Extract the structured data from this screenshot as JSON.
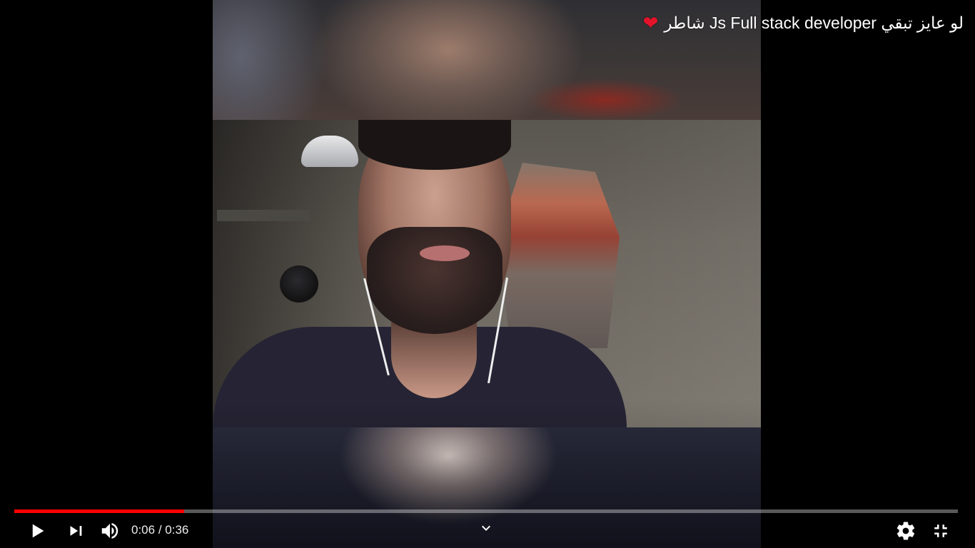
{
  "video": {
    "title": "لو عايز تبقي Js Full stack developer شاطر",
    "title_icon": "heart-icon",
    "title_icon_glyph": "❤"
  },
  "player": {
    "current_time": "0:06",
    "duration": "0:36",
    "time_separator": " / ",
    "progress_played_fraction": 0.18,
    "progress_loaded_fraction": 0.18,
    "colors": {
      "progress_played": "#ff0000",
      "heart": "#e5132a"
    },
    "controls": {
      "play_icon": "play-icon",
      "next_icon": "next-icon",
      "volume_icon": "volume-icon",
      "chevron_icon": "chevron-down-icon",
      "settings_icon": "gear-icon",
      "exit_fullscreen_icon": "exit-fullscreen-icon"
    }
  }
}
